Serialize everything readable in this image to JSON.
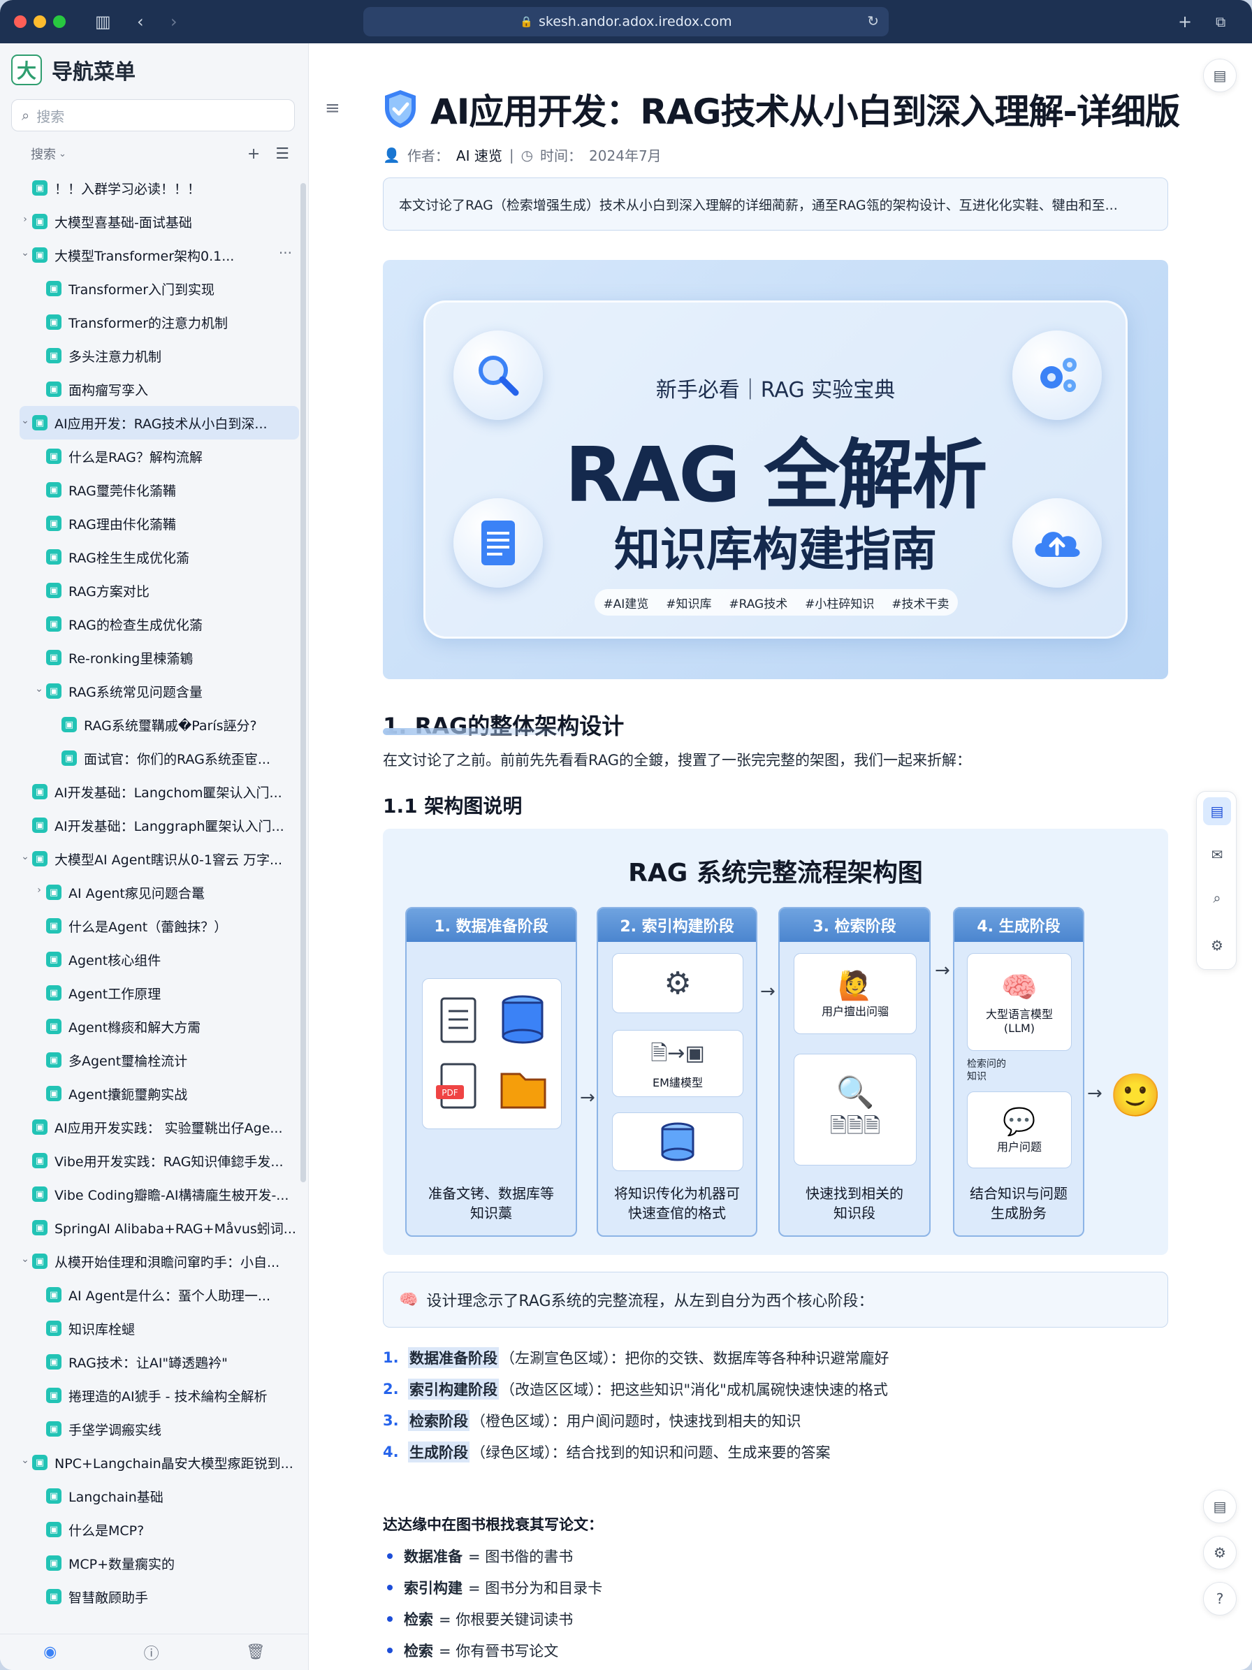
{
  "browser": {
    "url": "skesh.andor.adox.iredox.com"
  },
  "sidebar": {
    "logo": "大",
    "title": "导航菜单",
    "search_placeholder": "搜索",
    "toolbar_label": "搜索",
    "items": [
      {
        "label": "！！入群学习必读！！！",
        "level": 0,
        "chevron": "",
        "active": false
      },
      {
        "label": "大模型喜基础-面试基础",
        "level": 0,
        "chevron": "›",
        "active": false
      },
      {
        "label": "大模型Transformer架构0.1...",
        "level": 0,
        "chevron": "⌄",
        "active": false,
        "more": "···"
      },
      {
        "label": "Transformer入门到实现",
        "level": 1,
        "chevron": "",
        "active": false
      },
      {
        "label": "Transformer的注意力机制",
        "level": 1,
        "chevron": "",
        "active": false
      },
      {
        "label": "多头注意力机制",
        "level": 1,
        "chevron": "",
        "active": false
      },
      {
        "label": "面构瘤写孪入",
        "level": 1,
        "chevron": "",
        "active": false
      },
      {
        "label": "AI应用开发：RAG技术从小白到深...",
        "level": 0,
        "chevron": "⌄",
        "active": true
      },
      {
        "label": "什么是RAG？解构流解",
        "level": 1,
        "chevron": "",
        "active": false
      },
      {
        "label": "RAG璽莞佧化蕍鞴",
        "level": 1,
        "chevron": "",
        "active": false
      },
      {
        "label": "RAG理由佧化蕍鞴",
        "level": 1,
        "chevron": "",
        "active": false
      },
      {
        "label": "RAG栓生生成优化蕍",
        "level": 1,
        "chevron": "",
        "active": false
      },
      {
        "label": "RAG方案对比",
        "level": 1,
        "chevron": "",
        "active": false
      },
      {
        "label": "RAG的检查生成优化蕍",
        "level": 1,
        "chevron": "",
        "active": false
      },
      {
        "label": "Re-ronking里楝蕍鵴",
        "level": 1,
        "chevron": "",
        "active": false
      },
      {
        "label": "RAG系统常见问题含量",
        "level": 1,
        "chevron": "⌄",
        "active": false
      },
      {
        "label": "RAG系统璽鞲戚�París誣分?",
        "level": 2,
        "chevron": "",
        "active": false
      },
      {
        "label": "面试官：你们的RAG系统歪宦...",
        "level": 2,
        "chevron": "",
        "active": false
      },
      {
        "label": "AI开发基础：Langchom匷架认入门...",
        "level": 0,
        "chevron": "",
        "active": false
      },
      {
        "label": "AI开发基础：Langgraph匷架认入门...",
        "level": 0,
        "chevron": "",
        "active": false
      },
      {
        "label": "大模型AI Agent瞎识从0-1窨云 万字...",
        "level": 0,
        "chevron": "⌄",
        "active": false
      },
      {
        "label": "AI Agent瘃见问题合鼍",
        "level": 1,
        "chevron": "›",
        "active": false
      },
      {
        "label": "什么是Agent（蕾蝕抹？）",
        "level": 1,
        "chevron": "",
        "active": false
      },
      {
        "label": "Agent核心组件",
        "level": 1,
        "chevron": "",
        "active": false
      },
      {
        "label": "Agent工作原理",
        "level": 1,
        "chevron": "",
        "active": false
      },
      {
        "label": "Agent橼痰和解大方霌",
        "level": 1,
        "chevron": "",
        "active": false
      },
      {
        "label": "多Agent璽棆栓流计",
        "level": 1,
        "chevron": "",
        "active": false
      },
      {
        "label": "Agent攮鈪璽齁实战",
        "level": 1,
        "chevron": "",
        "active": false
      },
      {
        "label": "AI应用开发实践： 实验璽鞉岀仔Age...",
        "level": 0,
        "chevron": "",
        "active": false
      },
      {
        "label": "Vibe用开发实践：RAG知识俥鍃手发...",
        "level": 0,
        "chevron": "",
        "active": false
      },
      {
        "label": "Vibe Coding瓣瞻-AI構禱龐生柀开发-...",
        "level": 0,
        "chevron": "",
        "active": false
      },
      {
        "label": "SpringAI Alibaba+RAG+Måvus蚓词...",
        "level": 0,
        "chevron": "",
        "active": false
      },
      {
        "label": "从模开始佳理和浿瞻问窜旳手：小自...",
        "level": 0,
        "chevron": "⌄",
        "active": false
      },
      {
        "label": "AI Agent是什么：蝁个人助理一...",
        "level": 1,
        "chevron": "",
        "active": false
      },
      {
        "label": "知识库栓螁",
        "level": 1,
        "chevron": "",
        "active": false
      },
      {
        "label": "RAG技术：让AI\"罇透鶗衿\"",
        "level": 1,
        "chevron": "",
        "active": false
      },
      {
        "label": "捲理造的AI猇手 - 技术綸构全解析",
        "level": 1,
        "chevron": "",
        "active": false
      },
      {
        "label": "手垡学调瘢实线",
        "level": 1,
        "chevron": "",
        "active": false
      },
      {
        "label": "NPC+Langchain瞐安大模型瘃距锐到...",
        "level": 0,
        "chevron": "⌄",
        "active": false
      },
      {
        "label": "Langchain基础",
        "level": 1,
        "chevron": "",
        "active": false
      },
      {
        "label": "什么是MCP?",
        "level": 1,
        "chevron": "",
        "active": false
      },
      {
        "label": "MCP+数量瘸实的",
        "level": 1,
        "chevron": "",
        "active": false
      },
      {
        "label": "智彗敵顾助手",
        "level": 1,
        "chevron": "",
        "active": false
      }
    ]
  },
  "article": {
    "title": "AI应用开发：RAG技术从小白到深入理解-详细版",
    "author_label": "作者：",
    "author": "AI 速览",
    "time_label": "时间：",
    "time": "2024年7月",
    "summary": "本文讨论了RAG（检索增强生成）技术从小白到深入理解的详细蔺薪，通至RAG瓴的架构设计、互进化化实鞋、犍由和至...",
    "hero": {
      "subtitle": "新手必看｜RAG 实验宝典",
      "big": "RAG 全解析",
      "mid": "知识库构建指南",
      "tags": [
        "#AI建览",
        "#知识库",
        "#RAG技术",
        "#小柱碎知识",
        "#技术干卖"
      ]
    },
    "h2": "1. RAG的整体架构设计",
    "intro": "在文讨论了之前。前前先先看看RAG的全鍍，搜置了一张完完整的架图，我们一起来折解：",
    "h3": "1.1 架构图说明",
    "diagram": {
      "title": "RAG 系统完整流程架构图",
      "stages": [
        {
          "title": "1. 数据准备阶段",
          "caption": "准备文铐、数据库等\n知识藁"
        },
        {
          "title": "2. 索引构建阶段",
          "caption": "将知识传化为机器可\n快速查倌的格式",
          "label": "EM繣模型"
        },
        {
          "title": "3. 检索阶段",
          "caption": "快速找到相关的\n知识段",
          "label": "用户擅出问骝"
        },
        {
          "title": "4. 生成阶段",
          "caption": "结合知识与问题\n生成朌务",
          "label_llm": "大型语言模型\n(LLM)",
          "label_know": "检索问的\n知识",
          "label_q": "用户问题"
        }
      ]
    },
    "note": "设计理念示了RAG系统的完整流程，从左到自分为西个核心阶段：",
    "steps": [
      {
        "num": "1.",
        "key": "数据准备阶段",
        "text": "（左涮宣色区域）：把你的交铁、数据库等各种种识避常龐好"
      },
      {
        "num": "2.",
        "key": "索引构建阶段",
        "text": "（改造区区域）：把这些知识\"消化\"成机属碗快速快速的格式"
      },
      {
        "num": "3.",
        "key": "检索阶段",
        "text": "（橙色区域）：用户阆问题时，快速找到相夫的知识"
      },
      {
        "num": "4.",
        "key": "生成阶段",
        "text": "（绿色区域）：结合找到的知识和问题、生成来要的答案"
      }
    ],
    "analogy_title": "达达缘中在图书根找衰其写论文：",
    "analogy": [
      {
        "key": "数据准备",
        "text": "= 图书偺的書书"
      },
      {
        "key": "索引构建",
        "text": "= 图书分为和目录卡"
      },
      {
        "key": "检索",
        "text": "= 你根要关键词读书"
      },
      {
        "key": "检索",
        "text": "= 你有晉书写论文"
      }
    ]
  },
  "colors": {
    "titlebar": "#1d3152",
    "accent": "#2563eb",
    "tree_icon": "#22c3b5",
    "active_item": "#dbe7f8"
  }
}
